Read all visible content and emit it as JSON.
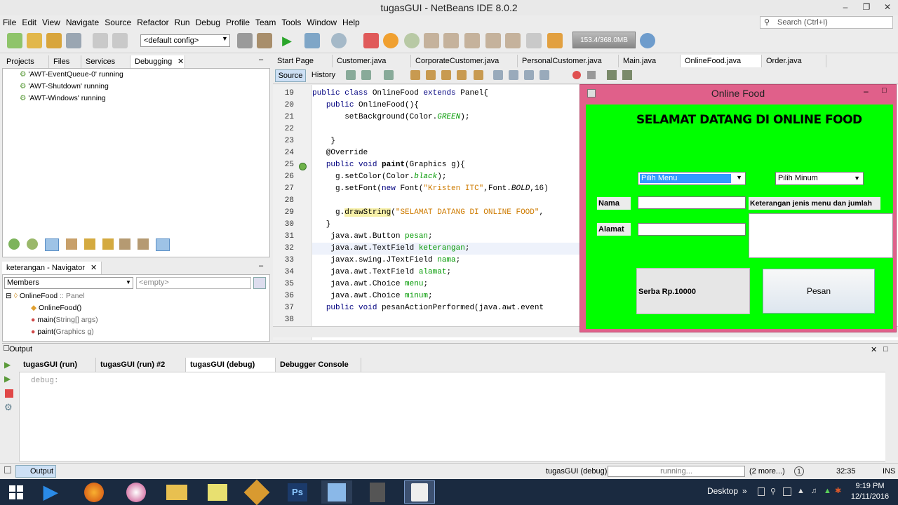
{
  "window": {
    "title": "tugasGUI - NetBeans IDE 8.0.2",
    "min": "–",
    "max": "❐",
    "close": "✕"
  },
  "menu": [
    "File",
    "Edit",
    "View",
    "Navigate",
    "Source",
    "Refactor",
    "Run",
    "Debug",
    "Profile",
    "Team",
    "Tools",
    "Window",
    "Help"
  ],
  "search": {
    "placeholder": "Search (Ctrl+I)"
  },
  "toolbar": {
    "config": "<default config>",
    "memory": "153.4/368.0MB"
  },
  "left_tabs": [
    "Projects",
    "Files",
    "Services",
    "Debugging"
  ],
  "threads": [
    "'AWT-EventQueue-0' running",
    "'AWT-Shutdown' running",
    "'AWT-Windows' running"
  ],
  "navigator": {
    "title": "keterangan - Navigator",
    "members": "Members",
    "empty": "<empty>",
    "root": "OnlineFood",
    "root_suffix": ":: Panel",
    "items": [
      {
        "name": "OnlineFood()",
        "args": ""
      },
      {
        "name": "main(",
        "args": "String[] args)"
      },
      {
        "name": "paint(",
        "args": "Graphics g)"
      }
    ]
  },
  "editor_tabs": [
    "Start Page",
    "Customer.java",
    "CorporateCustomer.java",
    "PersonalCustomer.java",
    "Main.java",
    "OnlineFood.java",
    "Order.java"
  ],
  "editor_modes": {
    "source": "Source",
    "history": "History"
  },
  "code": {
    "line_numbers": [
      "19",
      "20",
      "21",
      "22",
      "23",
      "24",
      "25",
      "26",
      "27",
      "28",
      "29",
      "30",
      "31",
      "32",
      "33",
      "34",
      "35",
      "36",
      "37",
      "38"
    ]
  },
  "app_frame": {
    "title": "Online Food",
    "heading": "SELAMAT DATANG DI ONLINE FOOD",
    "menu_choice": "Pilih Menu",
    "minum_choice": "Pilih Minum",
    "nama_label": "Nama",
    "alamat_label": "Alamat",
    "keterangan_label": "Keterangan jenis menu dan jumlah",
    "serba_label": "Serba Rp.10000",
    "pesan_button": "Pesan",
    "bg_color": "#00ff00",
    "frame_color": "#e0608a"
  },
  "output": {
    "title": "Output",
    "tabs": [
      "tugasGUI (run)",
      "tugasGUI (run) #2",
      "tugasGUI (debug)",
      "Debugger Console"
    ],
    "text": "debug:"
  },
  "status": {
    "output_tab": "Output",
    "process": "tugasGUI (debug)",
    "state": "running...",
    "more": "(2 more...)",
    "position": "32:35",
    "mode": "INS"
  },
  "taskbar": {
    "desktop": "Desktop",
    "time": "9:19 PM",
    "date": "12/11/2016"
  }
}
